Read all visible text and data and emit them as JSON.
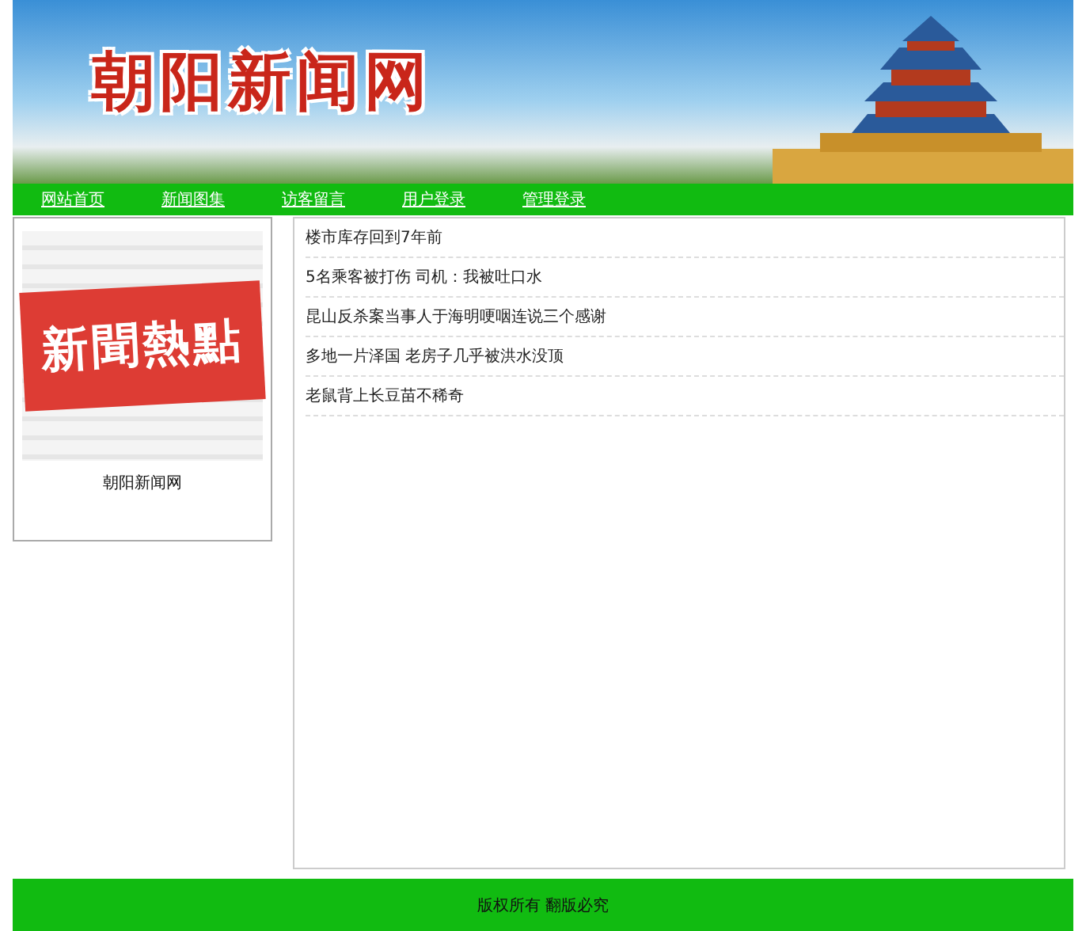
{
  "banner": {
    "title": "朝阳新闻网"
  },
  "nav": [
    {
      "label": "网站首页"
    },
    {
      "label": "新闻图集"
    },
    {
      "label": "访客留言"
    },
    {
      "label": "用户登录"
    },
    {
      "label": "管理登录"
    }
  ],
  "sidebar": {
    "graphic_text": "新聞熱點",
    "caption": "朝阳新闻网"
  },
  "news": [
    {
      "title": "楼市库存回到7年前"
    },
    {
      "title": "5名乘客被打伤 司机：我被吐口水"
    },
    {
      "title": "昆山反杀案当事人于海明哽咽连说三个感谢"
    },
    {
      "title": "多地一片泽国 老房子几乎被洪水没顶"
    },
    {
      "title": "老鼠背上长豆苗不稀奇"
    }
  ],
  "footer": {
    "text": "版权所有 翻版必究"
  }
}
